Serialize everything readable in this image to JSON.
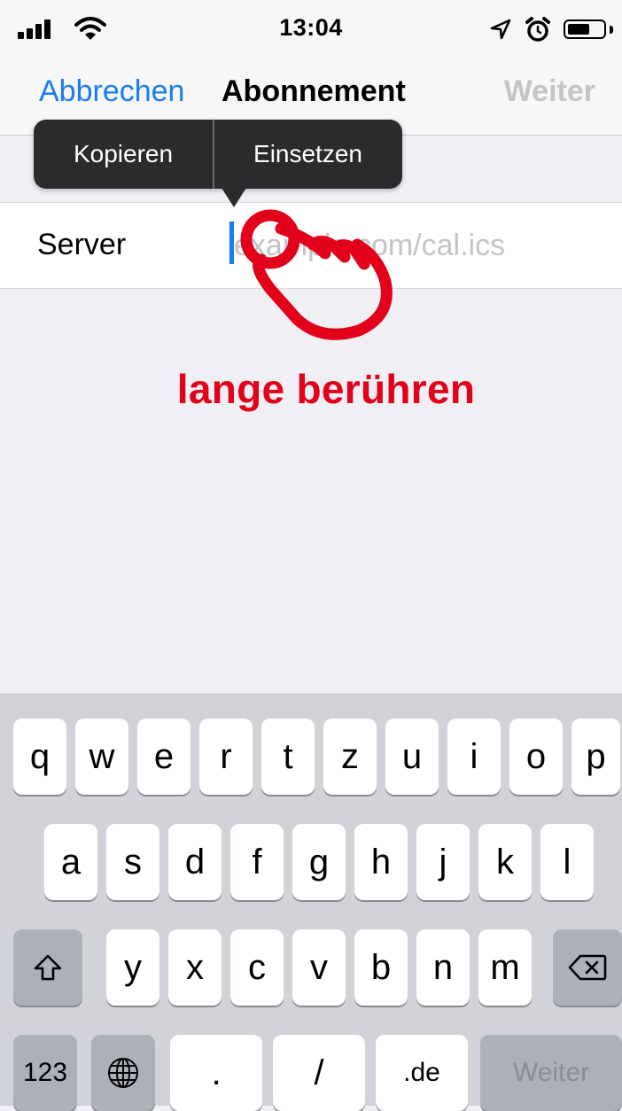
{
  "status_bar": {
    "time": "13:04",
    "icons": [
      "signal-icon",
      "wifi-icon",
      "location-arrow-icon",
      "alarm-clock-icon",
      "battery-icon"
    ]
  },
  "nav": {
    "cancel_label": "Abbrechen",
    "title": "Abonnement",
    "next_label": "Weiter"
  },
  "edit_menu": {
    "copy_label": "Kopieren",
    "paste_label": "Einsetzen"
  },
  "form": {
    "server_label": "Server",
    "server_value": "",
    "server_placeholder": "example.com/cal.ics"
  },
  "annotation": {
    "hint": "lange berühren",
    "color": "#e2001a",
    "icon": "pointing-hand-icon"
  },
  "keyboard": {
    "row1": [
      "q",
      "w",
      "e",
      "r",
      "t",
      "z",
      "u",
      "i",
      "o",
      "p"
    ],
    "row2": [
      "a",
      "s",
      "d",
      "f",
      "g",
      "h",
      "j",
      "k",
      "l"
    ],
    "row3": [
      "y",
      "x",
      "c",
      "v",
      "b",
      "n",
      "m"
    ],
    "numbers_label": "123",
    "dot_label": ".",
    "slash_label": "/",
    "domain_label": ".de",
    "return_label": "Weiter"
  },
  "colors": {
    "accent": "#1a7cf3",
    "disabled": "#c4c4c7",
    "background": "#efeff4"
  }
}
